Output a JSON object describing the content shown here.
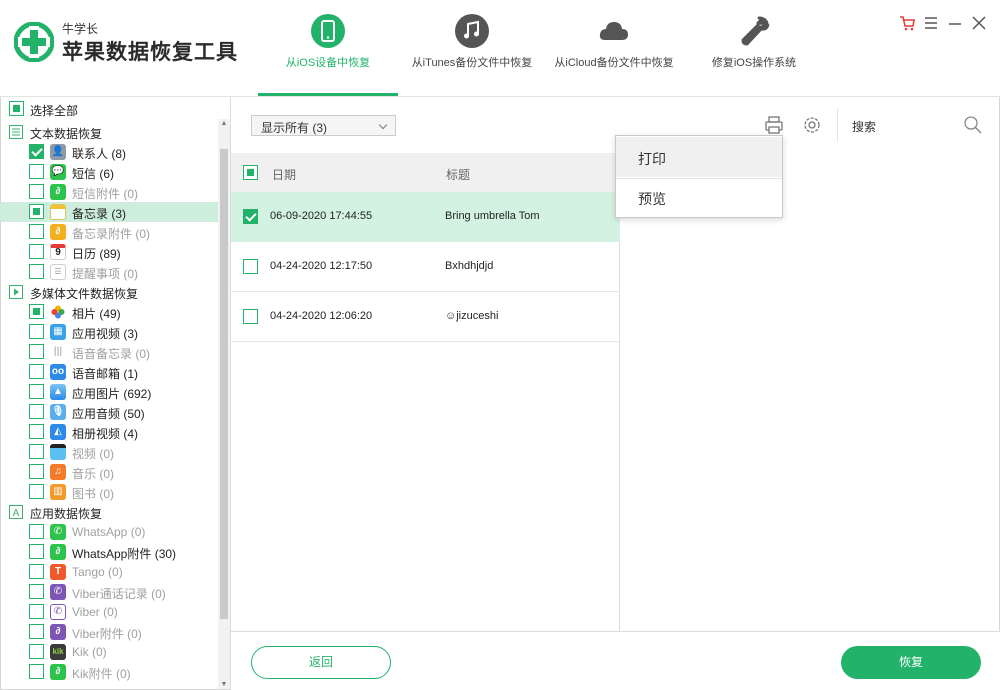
{
  "app": {
    "brand_small": "牛学长",
    "brand_big": "苹果数据恢复工具",
    "accent_color": "#22b26a"
  },
  "tabs": [
    {
      "label": "从iOS设备中恢复",
      "icon": "phone-icon",
      "active": true
    },
    {
      "label": "从iTunes备份文件中恢复",
      "icon": "music-note-icon",
      "active": false
    },
    {
      "label": "从iCloud备份文件中恢复",
      "icon": "cloud-icon",
      "active": false
    },
    {
      "label": "修复iOS操作系统",
      "icon": "wrench-icon",
      "active": false
    }
  ],
  "window_controls": [
    "cart-icon",
    "menu-icon",
    "minimize-icon",
    "close-icon"
  ],
  "sidebar": {
    "select_all": "选择全部",
    "categories": [
      {
        "label": "文本数据恢复",
        "items": [
          {
            "label": "联系人 (8)",
            "state": "checked",
            "dim": false,
            "icon": "contacts-icon"
          },
          {
            "label": "短信 (6)",
            "state": "none",
            "dim": false,
            "icon": "message-icon"
          },
          {
            "label": "短信附件 (0)",
            "state": "none",
            "dim": true,
            "icon": "attachment-icon"
          },
          {
            "label": "备忘录 (3)",
            "state": "partial",
            "dim": false,
            "icon": "notes-icon",
            "selected": true
          },
          {
            "label": "备忘录附件 (0)",
            "state": "none",
            "dim": true,
            "icon": "notes-attachment-icon"
          },
          {
            "label": "日历 (89)",
            "state": "none",
            "dim": false,
            "icon": "calendar-icon"
          },
          {
            "label": "提醒事项 (0)",
            "state": "none",
            "dim": true,
            "icon": "reminders-icon"
          }
        ]
      },
      {
        "label": "多媒体文件数据恢复",
        "items": [
          {
            "label": "相片 (49)",
            "state": "partial",
            "dim": false,
            "icon": "photos-icon"
          },
          {
            "label": "应用视频 (3)",
            "state": "none",
            "dim": false,
            "icon": "app-video-icon"
          },
          {
            "label": "语音备忘录 (0)",
            "state": "none",
            "dim": true,
            "icon": "voice-memo-icon"
          },
          {
            "label": "语音邮箱 (1)",
            "state": "none",
            "dim": false,
            "icon": "voicemail-icon"
          },
          {
            "label": "应用图片 (692)",
            "state": "none",
            "dim": false,
            "icon": "app-photo-icon"
          },
          {
            "label": "应用音频 (50)",
            "state": "none",
            "dim": false,
            "icon": "app-audio-icon"
          },
          {
            "label": "相册视频 (4)",
            "state": "none",
            "dim": false,
            "icon": "album-video-icon"
          },
          {
            "label": "视频 (0)",
            "state": "none",
            "dim": true,
            "icon": "video-icon"
          },
          {
            "label": "音乐 (0)",
            "state": "none",
            "dim": true,
            "icon": "music-icon"
          },
          {
            "label": "图书 (0)",
            "state": "none",
            "dim": true,
            "icon": "books-icon"
          }
        ]
      },
      {
        "label": "应用数据恢复",
        "items": [
          {
            "label": "WhatsApp (0)",
            "state": "none",
            "dim": true,
            "icon": "whatsapp-icon"
          },
          {
            "label": "WhatsApp附件 (30)",
            "state": "none",
            "dim": false,
            "icon": "whatsapp-attachment-icon"
          },
          {
            "label": "Tango (0)",
            "state": "none",
            "dim": true,
            "icon": "tango-icon"
          },
          {
            "label": "Viber通话记录 (0)",
            "state": "none",
            "dim": true,
            "icon": "viber-call-icon"
          },
          {
            "label": "Viber (0)",
            "state": "none",
            "dim": true,
            "icon": "viber-icon"
          },
          {
            "label": "Viber附件 (0)",
            "state": "none",
            "dim": true,
            "icon": "viber-attachment-icon"
          },
          {
            "label": "Kik (0)",
            "state": "none",
            "dim": true,
            "icon": "kik-icon"
          },
          {
            "label": "Kik附件 (0)",
            "state": "none",
            "dim": true,
            "icon": "kik-attachment-icon"
          }
        ]
      }
    ]
  },
  "toolbar": {
    "filter_value": "显示所有 (3)",
    "search_label": "搜索"
  },
  "list": {
    "col_date": "日期",
    "col_title": "标题",
    "rows": [
      {
        "date": "06-09-2020 17:44:55",
        "title": "Bring umbrella Tom",
        "checked": true,
        "selected": true
      },
      {
        "date": "04-24-2020 12:17:50",
        "title": "Bxhdhjdjd",
        "checked": false,
        "selected": false
      },
      {
        "date": "04-24-2020 12:06:20",
        "title": "☺jizuceshi",
        "checked": false,
        "selected": false
      }
    ]
  },
  "popup": {
    "print": "打印",
    "preview": "预览"
  },
  "footer": {
    "back": "返回",
    "recover": "恢复"
  }
}
